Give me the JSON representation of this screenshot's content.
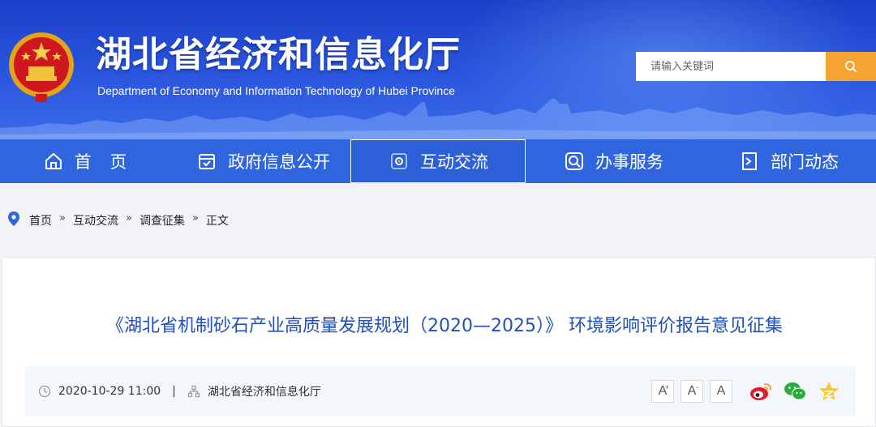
{
  "header": {
    "title": "湖北省经济和信息化厅",
    "subtitle": "Department of Economy and Information Technology of Hubei Province",
    "search_placeholder": "请输入关键词"
  },
  "nav": {
    "items": [
      {
        "label": "首 页",
        "icon": "home-icon"
      },
      {
        "label": "政府信息公开",
        "icon": "document-icon"
      },
      {
        "label": "互动交流",
        "icon": "interaction-icon",
        "active": true
      },
      {
        "label": "办事服务",
        "icon": "service-icon"
      },
      {
        "label": "部门动态",
        "icon": "news-icon"
      }
    ]
  },
  "breadcrumb": {
    "items": [
      "首页",
      "互动交流",
      "调查征集",
      "正文"
    ],
    "separator": "»"
  },
  "article": {
    "title": "《湖北省机制砂石产业高质量发展规划（2020—2025）》 环境影响评价报告意见征集",
    "date": "2020-10-29 11:00",
    "divider": "|",
    "source": "湖北省经济和信息化厅",
    "font_buttons": [
      "A",
      "A",
      "A"
    ],
    "font_button_marks": [
      "+",
      "-",
      ""
    ]
  },
  "colors": {
    "nav_bg": "#2f66e0",
    "search_button": "#f5a431",
    "title_blue": "#1f4fbf"
  }
}
